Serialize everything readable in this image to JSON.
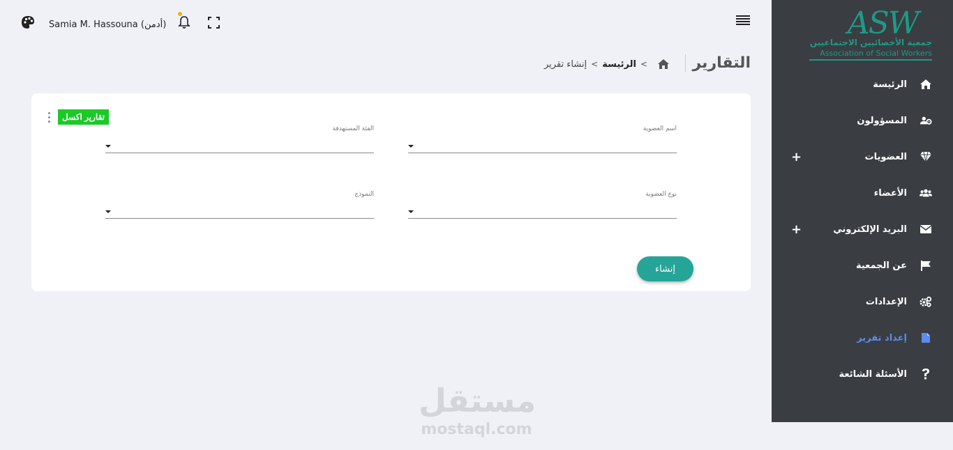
{
  "header": {
    "user_name": "Samia M. Hassouna (أدمن)"
  },
  "logo": {
    "letters": "ASW",
    "arabic": "جمعية الأخصائيين الاجتماعيين",
    "english": "Association of Social Workers"
  },
  "sidebar": {
    "items": [
      {
        "label": "الرئيسة",
        "icon": "home-icon"
      },
      {
        "label": "المسؤولون",
        "icon": "users-cog-icon"
      },
      {
        "label": "العضويات",
        "icon": "gem-icon",
        "expand": "+"
      },
      {
        "label": "الأعضاء",
        "icon": "users-icon"
      },
      {
        "label": "البريد الإلكتروني",
        "icon": "envelope-icon",
        "expand": "+"
      },
      {
        "label": "عن الجمعية",
        "icon": "flag-icon"
      },
      {
        "label": "الإعدادات",
        "icon": "cogs-icon"
      },
      {
        "label": "إعداد تقرير",
        "icon": "file-icon",
        "active": true
      },
      {
        "label": "الأسئلة الشائعة",
        "icon": "question-icon"
      }
    ]
  },
  "page": {
    "title": "التقارير",
    "breadcrumb": {
      "home": "الرئيسة",
      "separator": ">",
      "current": "إنشاء تقرير"
    }
  },
  "form": {
    "excel_button": "تقارير اكسل",
    "fields": {
      "membership_name": "اسم العضوية",
      "target_group": "الفئة المستهدفة",
      "membership_type": "نوع العضوية",
      "template": "النموذج"
    },
    "submit": "إنشاء"
  },
  "watermark": {
    "arabic": "مستقل",
    "english": "mostaql.com"
  },
  "colors": {
    "sidebar_bg": "#3a3d42",
    "accent": "#25a597",
    "excel_green": "#1bc927",
    "active_link": "#5b8def",
    "logo_green": "#1e9a86"
  }
}
